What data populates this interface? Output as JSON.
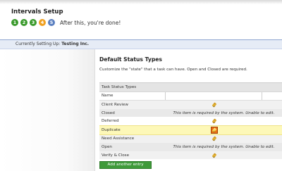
{
  "header": {
    "title": "Intervals Setup",
    "steps": [
      {
        "number": "1",
        "color": "#3a9a2c"
      },
      {
        "number": "2",
        "color": "#3a9a2c"
      },
      {
        "number": "3",
        "color": "#3a9a2c"
      },
      {
        "number": "4",
        "color": "#f0a020"
      },
      {
        "number": "5",
        "color": "#5a7fc0"
      }
    ],
    "steps_text": "After this, you're done!"
  },
  "setup_bar": {
    "label": "Currently Setting Up:",
    "value": "Testing Inc."
  },
  "section": {
    "title": "Default Status Types",
    "description": "Customize the \"state\" that a task can have. Open and Closed are required."
  },
  "table": {
    "caption": "Task Status Types",
    "column_name": "Name",
    "rows": [
      {
        "name": "Client Review",
        "note": "",
        "icon": "pencil-icon"
      },
      {
        "name": "Closed",
        "note": "This item is required by the system. Unable to edit.",
        "icon": ""
      },
      {
        "name": "Deferred",
        "note": "",
        "icon": "pencil-icon"
      },
      {
        "name": "Duplicate",
        "note": "",
        "icon": "pencil-icon"
      },
      {
        "name": "Need Assistance",
        "note": "",
        "icon": "pencil-icon"
      },
      {
        "name": "Open",
        "note": "This item is required by the system. Unable to edit.",
        "icon": ""
      },
      {
        "name": "Verify & Close",
        "note": "",
        "icon": "pencil-icon"
      }
    ]
  },
  "add_button_label": "Add another entry",
  "colors": {
    "step_done": "#3a9a2c",
    "step_current": "#f0a020",
    "step_next": "#5a7fc0",
    "setup_bar_bg": "#e6ecf6",
    "highlight_row": "#fdf8b8",
    "add_button": "#3f9a3a"
  }
}
